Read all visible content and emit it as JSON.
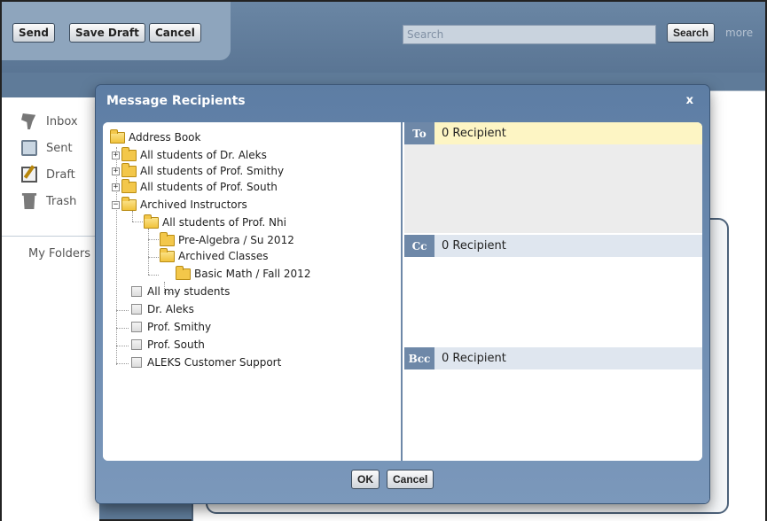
{
  "toolbar": {
    "send_label": "Send",
    "save_draft_label": "Save Draft",
    "cancel_label": "Cancel",
    "search_placeholder": "Search",
    "search_button": "Search",
    "more_link": "more"
  },
  "sidebar": {
    "items": [
      {
        "label": "Inbox",
        "icon": "inbox-icon"
      },
      {
        "label": "Sent",
        "icon": "sent-icon"
      },
      {
        "label": "Draft",
        "icon": "draft-icon"
      },
      {
        "label": "Trash",
        "icon": "trash-icon"
      }
    ],
    "folders_label": "My Folders"
  },
  "modal": {
    "title": "Message Recipients",
    "close": "x",
    "tree": {
      "root": "Address Book",
      "groups": [
        "All students of Dr. Aleks",
        "All students of Prof. Smithy",
        "All students of Prof. South"
      ],
      "archived": {
        "label": "Archived Instructors",
        "instructor": "All students of Prof. Nhi",
        "course": "Pre-Algebra / Su 2012",
        "archived_classes": "Archived Classes",
        "archived_course": "Basic Math / Fall 2012"
      },
      "checkables": [
        "All my students",
        "Dr. Aleks",
        "Prof. Smithy",
        "Prof. South",
        "ALEKS Customer Support"
      ]
    },
    "recipients": {
      "to": {
        "tag": "To",
        "count": "0 Recipient"
      },
      "cc": {
        "tag": "Cc",
        "count": "0 Recipient"
      },
      "bcc": {
        "tag": "Bcc",
        "count": "0 Recipient"
      }
    },
    "ok_label": "OK",
    "cancel_label": "Cancel"
  },
  "colors": {
    "modal_blue": "#6a89ae",
    "to_highlight": "#fdf5c4",
    "header_gray": "#dfe6ef",
    "folder_yellow": "#f3c74a"
  }
}
